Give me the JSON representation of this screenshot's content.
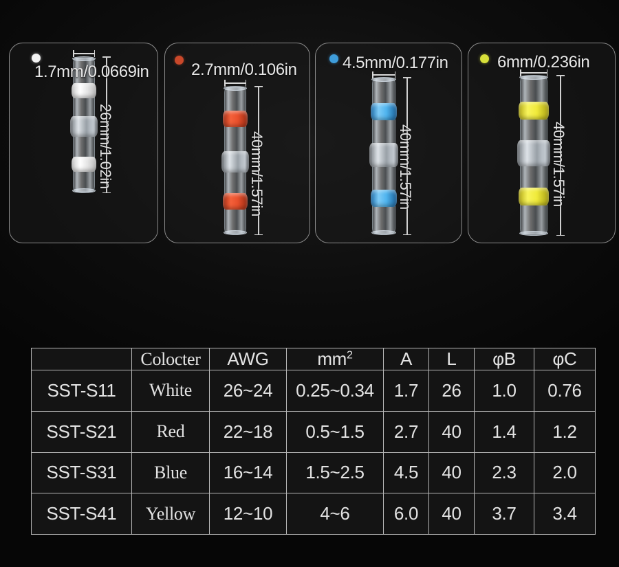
{
  "panels": [
    {
      "id": "white",
      "dot_color": "#f2f2f2",
      "size_label": "1.7mm/0.0669in",
      "length_label": "26mm/1.02in",
      "band_color": "#f4f4f4",
      "band_color_alt": "#e8e8e8"
    },
    {
      "id": "red",
      "dot_color": "#c9482a",
      "size_label": "2.7mm/0.106in",
      "length_label": "40mm/1.57in",
      "band_color": "#e8502c",
      "band_color_alt": "#c23a1c"
    },
    {
      "id": "blue",
      "dot_color": "#3e9ddb",
      "size_label": "4.5mm/0.177in",
      "length_label": "40mm/1.57in",
      "band_color": "#4fb4ee",
      "band_color_alt": "#2f8fd0"
    },
    {
      "id": "yellow",
      "dot_color": "#d8e03a",
      "size_label": "6mm/0.236in",
      "length_label": "40mm/1.57in",
      "band_color": "#f0ea3a",
      "band_color_alt": "#d4cc1e"
    }
  ],
  "table": {
    "headers": [
      "",
      "Colocter",
      "AWG",
      "mm",
      "A",
      "L",
      "φB",
      "φC"
    ],
    "header_mm_superscript": "2",
    "rows": [
      {
        "model": "SST-S11",
        "color": "White",
        "awg": "26~24",
        "mm2": "0.25~0.34",
        "a": "1.7",
        "l": "26",
        "phi_b": "1.0",
        "phi_c": "0.76"
      },
      {
        "model": "SST-S21",
        "color": "Red",
        "awg": "22~18",
        "mm2": "0.5~1.5",
        "a": "2.7",
        "l": "40",
        "phi_b": "1.4",
        "phi_c": "1.2"
      },
      {
        "model": "SST-S31",
        "color": "Blue",
        "awg": "16~14",
        "mm2": "1.5~2.5",
        "a": "4.5",
        "l": "40",
        "phi_b": "2.3",
        "phi_c": "2.0"
      },
      {
        "model": "SST-S41",
        "color": "Yellow",
        "awg": "12~10",
        "mm2": "4~6",
        "a": "6.0",
        "l": "40",
        "phi_b": "3.7",
        "phi_c": "3.4"
      }
    ]
  },
  "colors": {
    "background": "#090909",
    "panel_border": "#8c8c8c",
    "table_border": "#b9b9b9",
    "text": "#e3e3e3"
  }
}
